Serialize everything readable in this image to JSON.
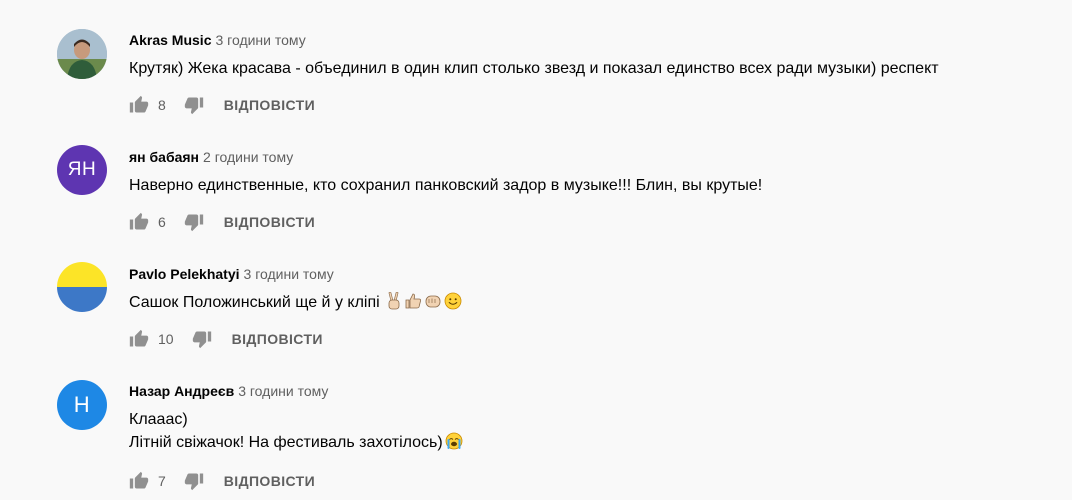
{
  "comments": [
    {
      "author": "Akras Music",
      "time": "3 години тому",
      "lines": [
        "Крутяк) Жека красава - объединил в один клип столько звезд и показал единство всех ради музыки) респект"
      ],
      "likes": "8",
      "avatar": {
        "type": "photo"
      }
    },
    {
      "author": "ян бабаян",
      "time": "2 години тому",
      "lines": [
        "Наверно единственные, кто сохранил панковский задор в музыке!!!  Блин, вы крутые!"
      ],
      "likes": "6",
      "avatar": {
        "type": "initials",
        "initials": "ЯН",
        "color": "#5e35b1"
      }
    },
    {
      "author": "Pavlo Pelekhatyi",
      "time": "3 години тому",
      "lines": [
        "Сашок Положинський ще й у кліпі"
      ],
      "likes": "10",
      "avatar": {
        "type": "flag",
        "top_color": "#fce427",
        "bottom_color": "#3d78c7"
      },
      "emojis": [
        "victory-hand-emoji",
        "thumbs-up-emoji",
        "fist-emoji",
        "smiling-face-emoji"
      ]
    },
    {
      "author": "Назар Андреєв",
      "time": "3 години тому",
      "lines": [
        "Клааас)",
        "Літній свіжачок! На фестиваль захотілось)"
      ],
      "likes": "7",
      "avatar": {
        "type": "initials",
        "initials": "Н",
        "color": "#1e88e5"
      },
      "emojis": [
        "crying-face-emoji"
      ]
    }
  ],
  "reply_label": "ВІДПОВІСТИ",
  "colors": {
    "background": "#f9f9f9",
    "secondary_text": "#606060",
    "primary_text": "#030303"
  }
}
